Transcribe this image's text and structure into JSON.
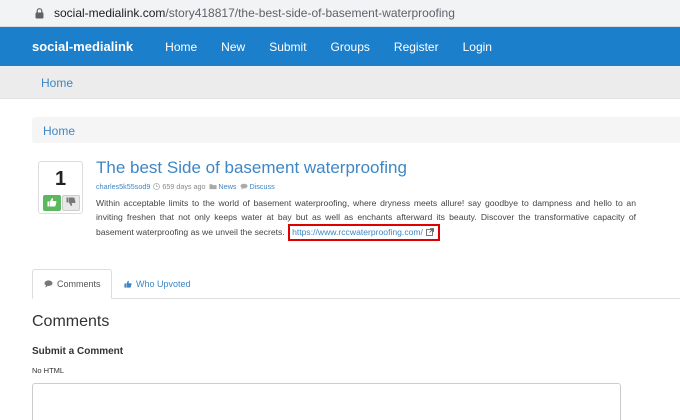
{
  "browser": {
    "url_host": "social-medialink.com",
    "url_path": "/story418817/the-best-side-of-basement-waterproofing"
  },
  "navbar": {
    "brand": "social-medialink",
    "links": [
      "Home",
      "New",
      "Submit",
      "Groups",
      "Register",
      "Login"
    ]
  },
  "breadcrumb_top": "Home",
  "breadcrumb_inner": "Home",
  "story": {
    "votes": "1",
    "title": "The best Side of basement waterproofing",
    "author": "charles5k55sod9",
    "time": "659 days ago",
    "category": "News",
    "discuss": "Discuss",
    "description": "Within acceptable limits to the world of basement waterproofing, where dryness meets allure! say goodbye to dampness and hello to an inviting freshen that not only keeps water at bay but as well as enchants afterward its beauty. Discover the transformative capacity of basement waterproofing as we unveil the secrets.",
    "link": "https://www.rccwaterproofing.com/"
  },
  "tabs": {
    "comments": "Comments",
    "who_upvoted": "Who Upvoted"
  },
  "comments_heading": "Comments",
  "submit_heading": "Submit a Comment",
  "no_html": "No HTML",
  "colors": {
    "navbar": "#1c7fcc",
    "link": "#3e86c5",
    "upvote": "#5cb85c",
    "highlight_box": "#e00000"
  },
  "icons": {
    "lock": "lock-icon",
    "upvote": "thumbs-up-icon",
    "downvote": "thumbs-down-icon",
    "clock": "clock-icon",
    "folder": "folder-icon",
    "comment": "comment-icon",
    "external": "external-link-icon"
  }
}
